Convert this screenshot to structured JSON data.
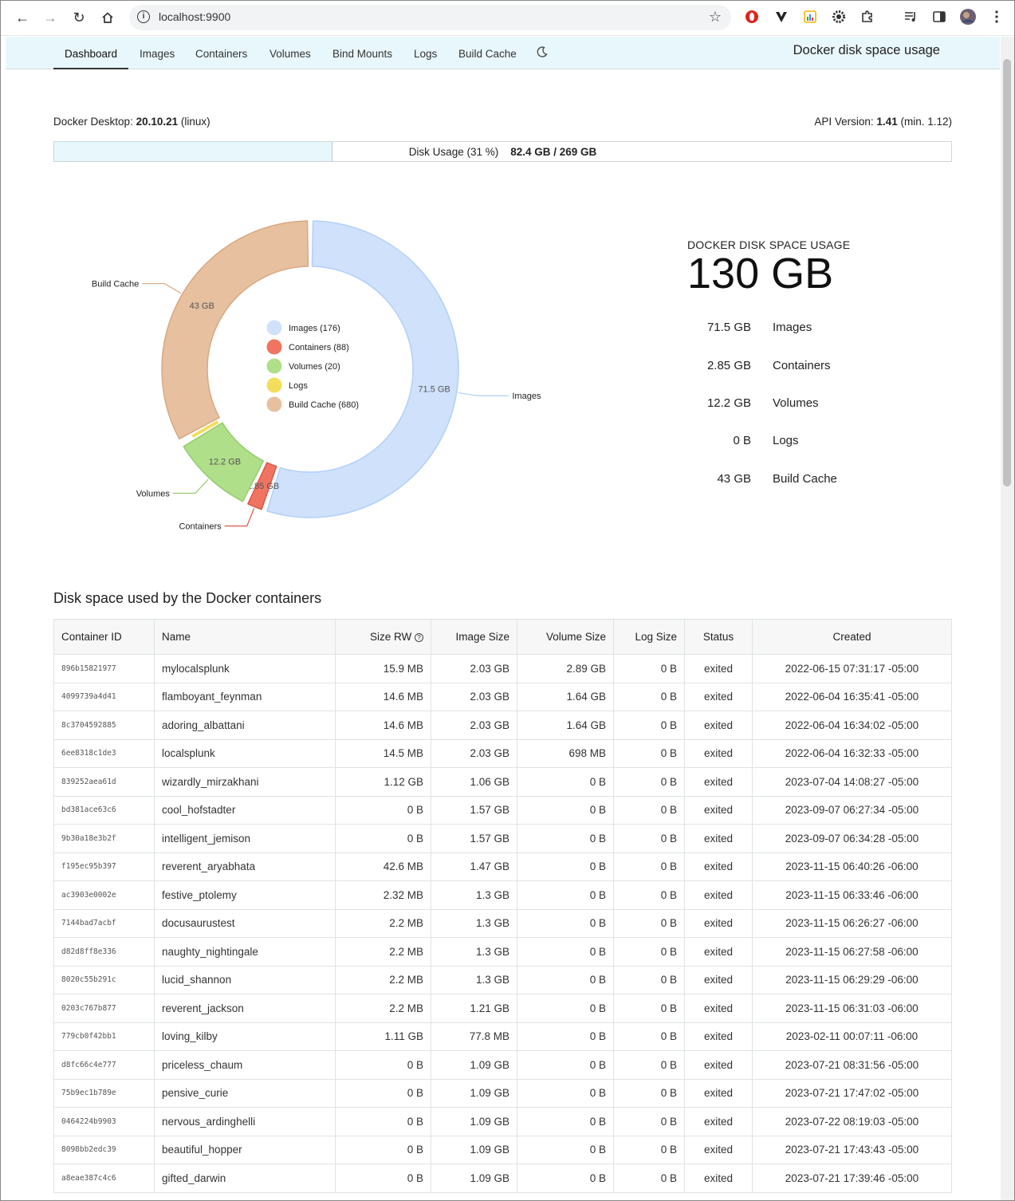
{
  "browser": {
    "url": "localhost:9900"
  },
  "nav": {
    "tabs": [
      "Dashboard",
      "Images",
      "Containers",
      "Volumes",
      "Bind Mounts",
      "Logs",
      "Build Cache"
    ],
    "active": "Dashboard",
    "brand": "Docker disk space usage"
  },
  "meta": {
    "desktop_label": "Docker Desktop:",
    "desktop_version": "20.10.21",
    "desktop_os": "(linux)",
    "api_label": "API Version:",
    "api_version": "1.41",
    "api_min": "(min. 1.12)"
  },
  "usage": {
    "label": "Disk Usage (31 %)",
    "value": "82.4 GB / 269 GB",
    "fraction": 0.31
  },
  "chart_data": {
    "type": "pie",
    "categories": [
      "Images",
      "Containers",
      "Volumes",
      "Logs",
      "Build Cache"
    ],
    "values": [
      71.5,
      2.85,
      12.2,
      0,
      43
    ],
    "value_labels": [
      "71.5 GB",
      "2.85 GB",
      "12.2 GB",
      "",
      "43 GB"
    ],
    "legend": [
      "Images (176)",
      "Containers (88)",
      "Volumes (20)",
      "Logs",
      "Build Cache (680)"
    ],
    "colors": [
      "#cfe1fb",
      "#f07461",
      "#b0df8a",
      "#f2de5c",
      "#e7c09f"
    ],
    "strokes": [
      "#b3cff8",
      "#d9594a",
      "#95cc6d",
      "#d8c446",
      "#d8a883"
    ],
    "legend_placement": "center"
  },
  "summary": {
    "title": "DOCKER DISK SPACE USAGE",
    "total": "130 GB",
    "rows": [
      {
        "value": "71.5 GB",
        "label": "Images"
      },
      {
        "value": "2.85 GB",
        "label": "Containers"
      },
      {
        "value": "12.2 GB",
        "label": "Volumes"
      },
      {
        "value": "0 B",
        "label": "Logs"
      },
      {
        "value": "43 GB",
        "label": "Build Cache"
      }
    ]
  },
  "containers": {
    "title": "Disk space used by the Docker containers",
    "columns": [
      "Container ID",
      "Name",
      "Size RW",
      "Image Size",
      "Volume Size",
      "Log Size",
      "Status",
      "Created"
    ],
    "rows": [
      [
        "896b15821977",
        "mylocalsplunk",
        "15.9 MB",
        "2.03 GB",
        "2.89 GB",
        "0 B",
        "exited",
        "2022-06-15 07:31:17 -05:00"
      ],
      [
        "4099739a4d41",
        "flamboyant_feynman",
        "14.6 MB",
        "2.03 GB",
        "1.64 GB",
        "0 B",
        "exited",
        "2022-06-04 16:35:41 -05:00"
      ],
      [
        "8c3704592885",
        "adoring_albattani",
        "14.6 MB",
        "2.03 GB",
        "1.64 GB",
        "0 B",
        "exited",
        "2022-06-04 16:34:02 -05:00"
      ],
      [
        "6ee8318c1de3",
        "localsplunk",
        "14.5 MB",
        "2.03 GB",
        "698 MB",
        "0 B",
        "exited",
        "2022-06-04 16:32:33 -05:00"
      ],
      [
        "839252aea61d",
        "wizardly_mirzakhani",
        "1.12 GB",
        "1.06 GB",
        "0 B",
        "0 B",
        "exited",
        "2023-07-04 14:08:27 -05:00"
      ],
      [
        "bd381ace63c6",
        "cool_hofstadter",
        "0 B",
        "1.57 GB",
        "0 B",
        "0 B",
        "exited",
        "2023-09-07 06:27:34 -05:00"
      ],
      [
        "9b30a18e3b2f",
        "intelligent_jemison",
        "0 B",
        "1.57 GB",
        "0 B",
        "0 B",
        "exited",
        "2023-09-07 06:34:28 -05:00"
      ],
      [
        "f195ec95b397",
        "reverent_aryabhata",
        "42.6 MB",
        "1.47 GB",
        "0 B",
        "0 B",
        "exited",
        "2023-11-15 06:40:26 -06:00"
      ],
      [
        "ac3903e0002e",
        "festive_ptolemy",
        "2.32 MB",
        "1.3 GB",
        "0 B",
        "0 B",
        "exited",
        "2023-11-15 06:33:46 -06:00"
      ],
      [
        "7144bad7acbf",
        "docusaurustest",
        "2.2 MB",
        "1.3 GB",
        "0 B",
        "0 B",
        "exited",
        "2023-11-15 06:26:27 -06:00"
      ],
      [
        "d82d8ff8e336",
        "naughty_nightingale",
        "2.2 MB",
        "1.3 GB",
        "0 B",
        "0 B",
        "exited",
        "2023-11-15 06:27:58 -06:00"
      ],
      [
        "8020c55b291c",
        "lucid_shannon",
        "2.2 MB",
        "1.3 GB",
        "0 B",
        "0 B",
        "exited",
        "2023-11-15 06:29:29 -06:00"
      ],
      [
        "0203c767b877",
        "reverent_jackson",
        "2.2 MB",
        "1.21 GB",
        "0 B",
        "0 B",
        "exited",
        "2023-11-15 06:31:03 -06:00"
      ],
      [
        "779cb0f42bb1",
        "loving_kilby",
        "1.11 GB",
        "77.8 MB",
        "0 B",
        "0 B",
        "exited",
        "2023-02-11 00:07:11 -06:00"
      ],
      [
        "d8fc66c4e777",
        "priceless_chaum",
        "0 B",
        "1.09 GB",
        "0 B",
        "0 B",
        "exited",
        "2023-07-21 08:31:56 -05:00"
      ],
      [
        "75b9ec1b789e",
        "pensive_curie",
        "0 B",
        "1.09 GB",
        "0 B",
        "0 B",
        "exited",
        "2023-07-21 17:47:02 -05:00"
      ],
      [
        "0464224b9903",
        "nervous_ardinghelli",
        "0 B",
        "1.09 GB",
        "0 B",
        "0 B",
        "exited",
        "2023-07-22 08:19:03 -05:00"
      ],
      [
        "8098bb2edc39",
        "beautiful_hopper",
        "0 B",
        "1.09 GB",
        "0 B",
        "0 B",
        "exited",
        "2023-07-21 17:43:43 -05:00"
      ],
      [
        "a8eae387c4c6",
        "gifted_darwin",
        "0 B",
        "1.09 GB",
        "0 B",
        "0 B",
        "exited",
        "2023-07-21 17:39:46 -05:00"
      ]
    ]
  }
}
